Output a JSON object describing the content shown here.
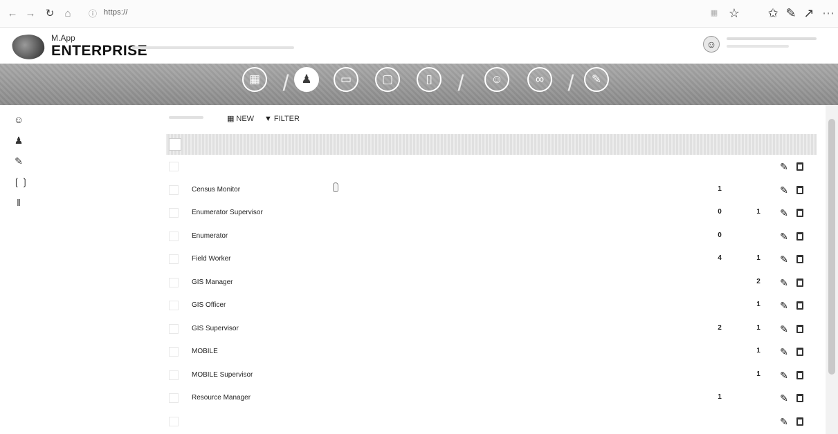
{
  "browser": {
    "back_glyph": "←",
    "forward_glyph": "→",
    "reload_glyph": "↻",
    "home_glyph": "⌂",
    "info_glyph": "ⓘ",
    "url_scheme": "https://",
    "url_host": "",
    "url_path": "",
    "bookmark_glyph": "☆",
    "favorites_glyph": "✩",
    "pen_glyph": "✎",
    "share_glyph": "↗",
    "more_glyph": "⋯"
  },
  "app": {
    "logo_small": "M.App",
    "logo_big": "ENTERPRISE",
    "avatar_glyph": "☺"
  },
  "modules": [
    {
      "glyph": "▦",
      "label": ""
    },
    {
      "glyph": "♟",
      "label": ""
    },
    {
      "glyph": "▭",
      "label": ""
    },
    {
      "glyph": "▢",
      "label": ""
    },
    {
      "glyph": "▯",
      "label": ""
    },
    {
      "glyph": "☺",
      "label": ""
    },
    {
      "glyph": "∞",
      "label": ""
    },
    {
      "glyph": "✎",
      "label": ""
    }
  ],
  "separator_glyph": "/",
  "sidebar": [
    {
      "glyph": "☺",
      "label": ""
    },
    {
      "glyph": "♟",
      "label": ""
    },
    {
      "glyph": "✎",
      "label": ""
    },
    {
      "glyph": "❲❳",
      "label": ""
    },
    {
      "glyph": "‖",
      "label": ""
    }
  ],
  "toolbar": {
    "new_icon": "▦",
    "new_label": "NEW",
    "filter_icon": "▼",
    "filter_label": "FILTER"
  },
  "table": {
    "rows": [
      {
        "name": "",
        "users": "",
        "apps": ""
      },
      {
        "name": "Census Monitor",
        "users": "1",
        "apps": ""
      },
      {
        "name": "Enumerator Supervisor",
        "users": "0",
        "apps": "1"
      },
      {
        "name": "Enumerator",
        "users": "0",
        "apps": ""
      },
      {
        "name": "Field Worker",
        "users": "4",
        "apps": "1"
      },
      {
        "name": "GIS Manager",
        "users": "",
        "apps": "2"
      },
      {
        "name": "GIS Officer",
        "users": "",
        "apps": "1"
      },
      {
        "name": "GIS Supervisor",
        "users": "2",
        "apps": "1"
      },
      {
        "name": "MOBILE",
        "users": "",
        "apps": "1"
      },
      {
        "name": "MOBILE Supervisor",
        "users": "",
        "apps": "1"
      },
      {
        "name": "Resource Manager",
        "users": "1",
        "apps": ""
      },
      {
        "name": "",
        "users": "",
        "apps": ""
      }
    ],
    "edit_glyph": "✎"
  }
}
